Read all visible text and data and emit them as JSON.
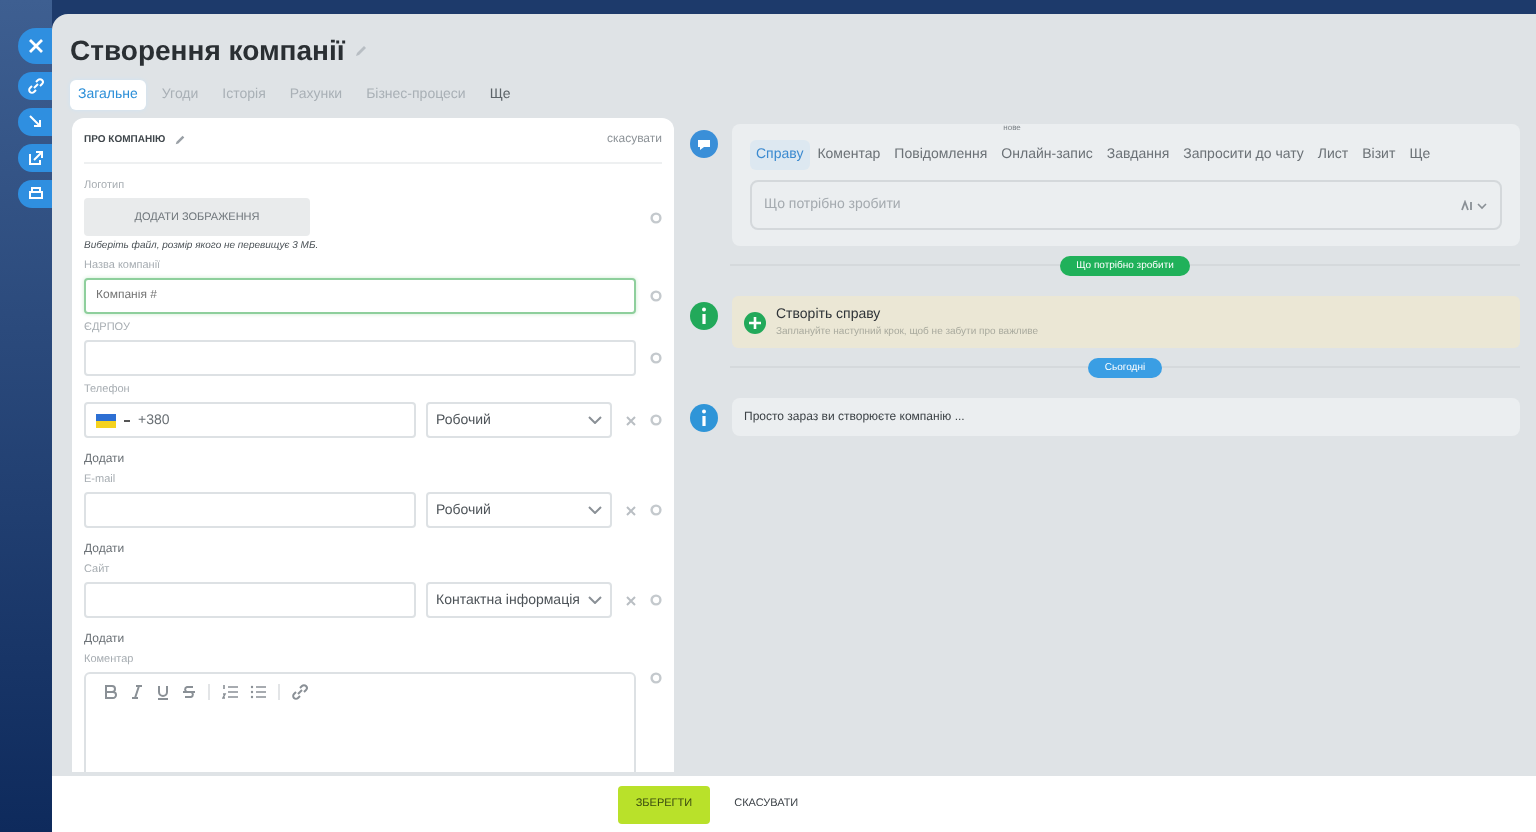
{
  "title": "Створення компанії",
  "tabs": [
    {
      "label": "Загальне",
      "selected": true
    },
    {
      "label": "Угоди",
      "selected": false
    },
    {
      "label": "Історія",
      "selected": false
    },
    {
      "label": "Рахунки",
      "selected": false
    },
    {
      "label": "Бізнес-процеси",
      "selected": false
    },
    {
      "label": "Ще",
      "selected": false
    }
  ],
  "card": {
    "title": "ПРО КОМПАНІЮ",
    "cancel": "скасувати"
  },
  "logo": {
    "label": "Логотип",
    "button": "ДОДАТИ ЗОБРАЖЕННЯ",
    "hint": "Виберіть файл, розмір якого не перевищує 3 МБ."
  },
  "fields": [
    {
      "kind": "text",
      "label": "Назва компанії",
      "placeholder": "Компанія #",
      "focused": true
    },
    {
      "kind": "text",
      "label": "ЄДРПОУ",
      "focused": false
    },
    {
      "kind": "multi",
      "label": "Телефон",
      "flag": true,
      "value": "+380",
      "type": "Робочий",
      "add": "Додати"
    },
    {
      "kind": "multi",
      "label": "E-mail",
      "flag": false,
      "type": "Робочий",
      "add": "Додати"
    },
    {
      "kind": "multi",
      "label": "Сайт",
      "flag": false,
      "type": "Контактна інформація",
      "add": "Додати"
    },
    {
      "kind": "editor",
      "label": "Коментар"
    }
  ],
  "activity": {
    "tabs": [
      {
        "label": "Справу",
        "selected": true
      },
      {
        "label": "Коментар",
        "selected": false
      },
      {
        "label": "Повідомлення",
        "selected": false
      },
      {
        "label": "Онлайн-запис",
        "selected": false,
        "badge": "нове"
      },
      {
        "label": "Завдання",
        "selected": false
      },
      {
        "label": "Запросити до чату",
        "selected": false
      },
      {
        "label": "Лист",
        "selected": false
      },
      {
        "label": "Візит",
        "selected": false
      },
      {
        "label": "Ще",
        "selected": false
      }
    ],
    "placeholder": "Що потрібно зробити"
  },
  "timeline": [
    {
      "kind": "divider",
      "label": "Що потрібно зробити",
      "color": "#20b15a"
    },
    {
      "kind": "todo",
      "title": "Створіть справу",
      "text": "Заплануйте наступний крок, щоб не забути про важливе"
    },
    {
      "kind": "divider",
      "label": "Сьогодні",
      "color": "#3a9ee4"
    },
    {
      "kind": "info",
      "text": "Просто зараз ви створюєте компанію ..."
    }
  ],
  "footer": {
    "save": "ЗБЕРЕГТИ",
    "cancel": "СКАСУВАТИ"
  }
}
